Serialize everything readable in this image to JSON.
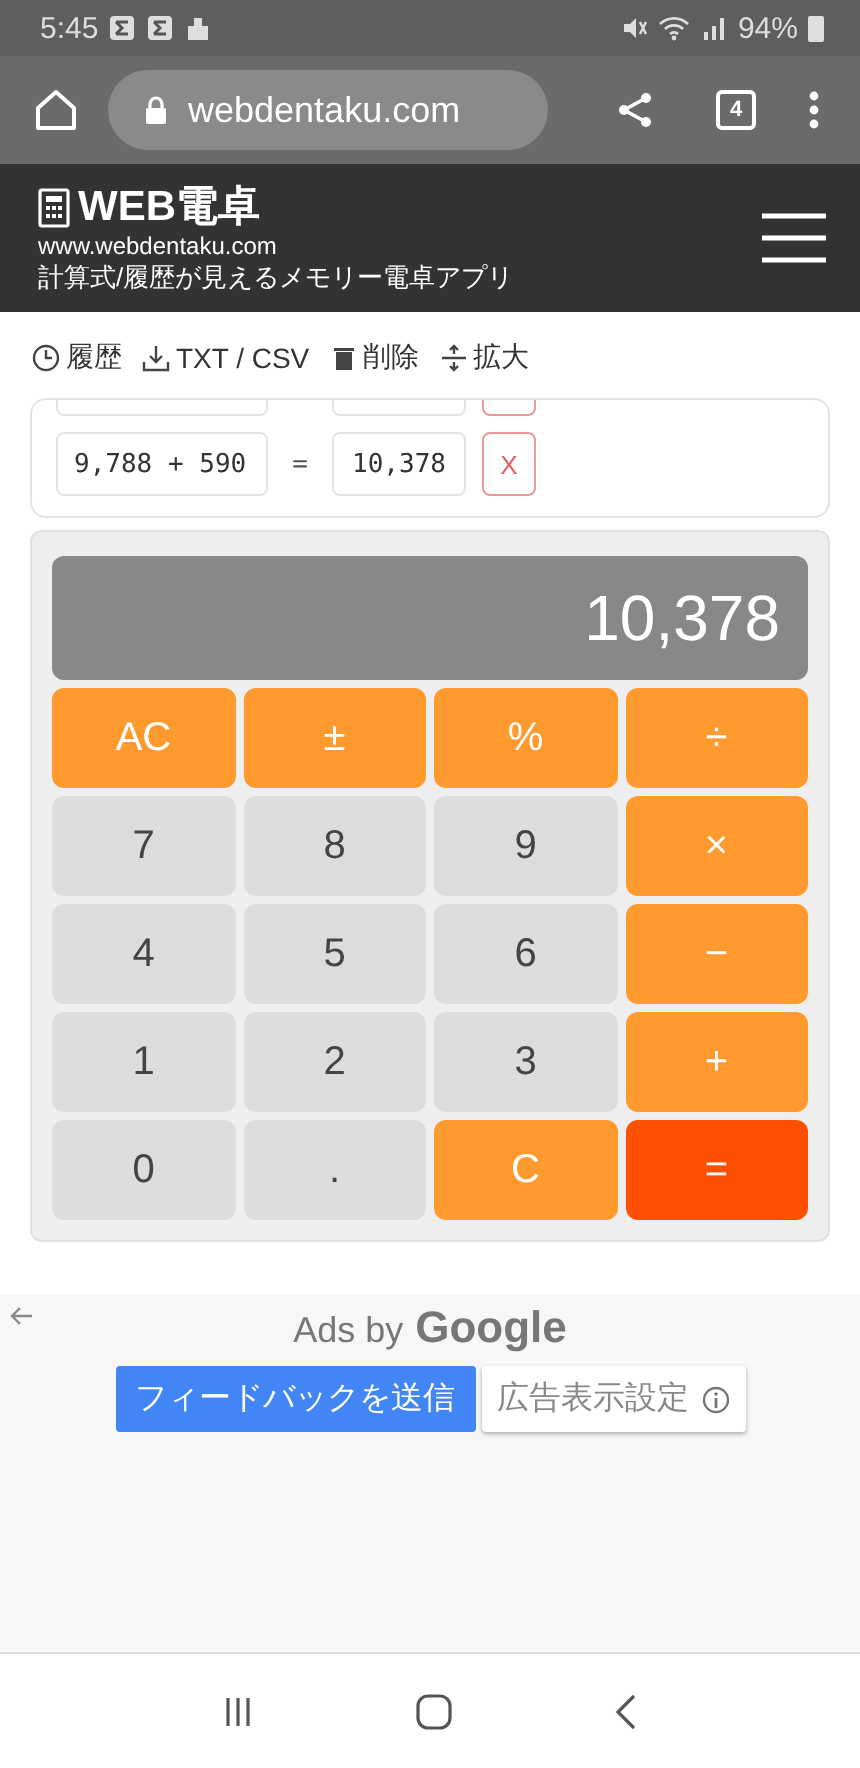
{
  "status_bar": {
    "time": "5:45",
    "battery": "94%"
  },
  "browser": {
    "url": "webdentaku.com",
    "tab_count": "4"
  },
  "site_header": {
    "title": "WEB電卓",
    "domain": "www.webdentaku.com",
    "tagline": "計算式/履歴が見えるメモリー電卓アプリ"
  },
  "toolbar": [
    {
      "kind": "history",
      "label": "履歴"
    },
    {
      "kind": "download",
      "label": "TXT / CSV"
    },
    {
      "kind": "delete",
      "label": "削除"
    },
    {
      "kind": "expand",
      "label": "拡大"
    }
  ],
  "history": [
    {
      "expression": "9,788 + 590",
      "equals": "=",
      "result": "10,378",
      "remove": "X"
    }
  ],
  "display": "10,378",
  "keys": [
    {
      "label": "AC",
      "kind": "op"
    },
    {
      "label": "±",
      "kind": "op"
    },
    {
      "label": "%",
      "kind": "op"
    },
    {
      "label": "÷",
      "kind": "op"
    },
    {
      "label": "7",
      "kind": "num"
    },
    {
      "label": "8",
      "kind": "num"
    },
    {
      "label": "9",
      "kind": "num"
    },
    {
      "label": "×",
      "kind": "op"
    },
    {
      "label": "4",
      "kind": "num"
    },
    {
      "label": "5",
      "kind": "num"
    },
    {
      "label": "6",
      "kind": "num"
    },
    {
      "label": "−",
      "kind": "op"
    },
    {
      "label": "1",
      "kind": "num"
    },
    {
      "label": "2",
      "kind": "num"
    },
    {
      "label": "3",
      "kind": "num"
    },
    {
      "label": "+",
      "kind": "op"
    },
    {
      "label": "0",
      "kind": "num"
    },
    {
      "label": ".",
      "kind": "num"
    },
    {
      "label": "C",
      "kind": "op"
    },
    {
      "label": "=",
      "kind": "equals"
    }
  ],
  "ads": {
    "ads_by": "Ads by",
    "brand": "Google",
    "feedback": "フィードバックを送信",
    "settings": "広告表示設定"
  }
}
